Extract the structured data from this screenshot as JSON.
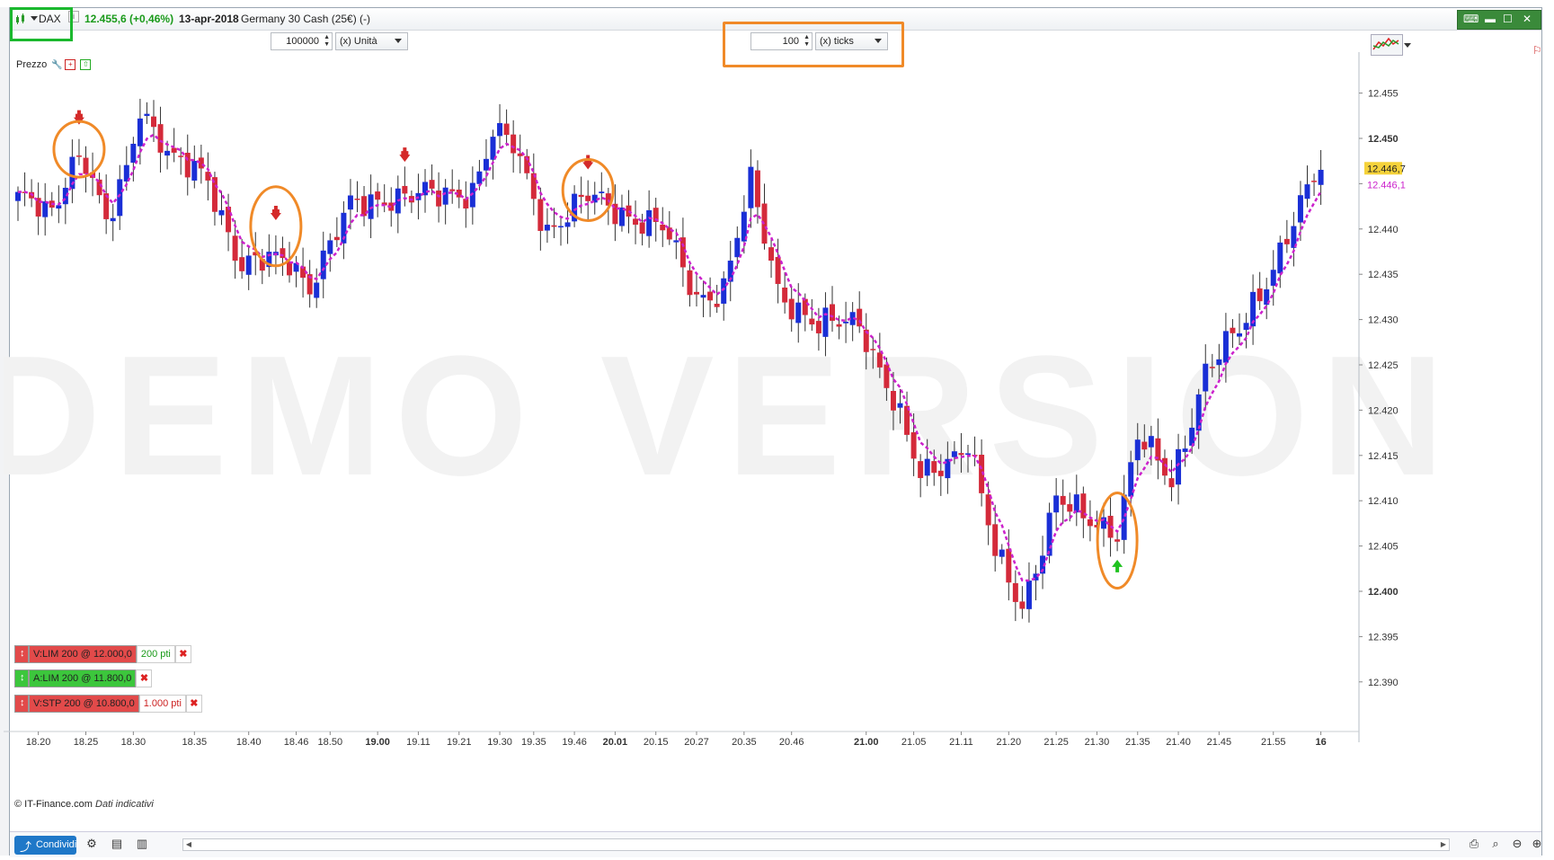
{
  "header": {
    "symbol": "DAX",
    "price_change": "12.455,6 (+0,46%)",
    "date": "13-apr-2018",
    "instrument": "Germany 30 Cash (25€) (-)"
  },
  "toolbar": {
    "units_value": "100000",
    "units_label": "(x) Unità",
    "ticks_value": "100",
    "ticks_label": "(x) ticks"
  },
  "panel": {
    "title": "Prezzo"
  },
  "orders": [
    {
      "label": "V:LIM  200 @ 12.000,0",
      "distance": "200 pti",
      "color": "#e24a4a",
      "distance_color": "#1a9a1a"
    },
    {
      "label": "A:LIM  200 @ 11.800,0",
      "distance": "",
      "color": "#3cc63c",
      "distance_color": "#1a9a1a"
    },
    {
      "label": "V:STP  200 @ 10.800,0",
      "distance": "1.000 pti",
      "color": "#e24a4a",
      "distance_color": "#c22"
    }
  ],
  "footer": {
    "credit": "© IT-Finance.com",
    "note": "Dati indicativi"
  },
  "bottom": {
    "share_label": "Condividi"
  },
  "watermark": "DEMO VERSION",
  "colors": {
    "bull": "#1a2fd6",
    "bear": "#d42a3a",
    "ma": "#cc22cc",
    "highlight": "#f08a28",
    "symbol_frame": "#1bb82e"
  },
  "chart_data": {
    "type": "candlestick",
    "ylim": [
      12.384,
      12.46
    ],
    "y_ticks": [
      {
        "v": 12.455,
        "label": "12.455",
        "bold": false
      },
      {
        "v": 12.45,
        "label": "12.450",
        "bold": true
      },
      {
        "v": 12.445,
        "label": "12.445",
        "bold": false
      },
      {
        "v": 12.44,
        "label": "12.440",
        "bold": false
      },
      {
        "v": 12.435,
        "label": "12.435",
        "bold": false
      },
      {
        "v": 12.43,
        "label": "12.430",
        "bold": false
      },
      {
        "v": 12.425,
        "label": "12.425",
        "bold": false
      },
      {
        "v": 12.42,
        "label": "12.420",
        "bold": false
      },
      {
        "v": 12.415,
        "label": "12.415",
        "bold": false
      },
      {
        "v": 12.41,
        "label": "12.410",
        "bold": false
      },
      {
        "v": 12.405,
        "label": "12.405",
        "bold": false
      },
      {
        "v": 12.4,
        "label": "12.400",
        "bold": true
      },
      {
        "v": 12.395,
        "label": "12.395",
        "bold": false
      },
      {
        "v": 12.39,
        "label": "12.390",
        "bold": false
      }
    ],
    "x_ticks": [
      {
        "i": 3,
        "label": "18.20",
        "bold": false
      },
      {
        "i": 10,
        "label": "18.25",
        "bold": false
      },
      {
        "i": 17,
        "label": "18.30",
        "bold": false
      },
      {
        "i": 26,
        "label": "18.35",
        "bold": false
      },
      {
        "i": 34,
        "label": "18.40",
        "bold": false
      },
      {
        "i": 41,
        "label": "18.46",
        "bold": false
      },
      {
        "i": 46,
        "label": "18.50",
        "bold": false
      },
      {
        "i": 53,
        "label": "19.00",
        "bold": true
      },
      {
        "i": 59,
        "label": "19.11",
        "bold": false
      },
      {
        "i": 65,
        "label": "19.21",
        "bold": false
      },
      {
        "i": 71,
        "label": "19.30",
        "bold": false
      },
      {
        "i": 76,
        "label": "19.35",
        "bold": false
      },
      {
        "i": 82,
        "label": "19.46",
        "bold": false
      },
      {
        "i": 88,
        "label": "20.01",
        "bold": true
      },
      {
        "i": 94,
        "label": "20.15",
        "bold": false
      },
      {
        "i": 100,
        "label": "20.27",
        "bold": false
      },
      {
        "i": 107,
        "label": "20.35",
        "bold": false
      },
      {
        "i": 114,
        "label": "20.46",
        "bold": false
      },
      {
        "i": 125,
        "label": "21.00",
        "bold": true
      },
      {
        "i": 132,
        "label": "21.05",
        "bold": false
      },
      {
        "i": 139,
        "label": "21.11",
        "bold": false
      },
      {
        "i": 146,
        "label": "21.20",
        "bold": false
      },
      {
        "i": 153,
        "label": "21.25",
        "bold": false
      },
      {
        "i": 159,
        "label": "21.30",
        "bold": false
      },
      {
        "i": 165,
        "label": "21.35",
        "bold": false
      },
      {
        "i": 171,
        "label": "21.40",
        "bold": false
      },
      {
        "i": 177,
        "label": "21.45",
        "bold": false
      },
      {
        "i": 185,
        "label": "21.55",
        "bold": false
      },
      {
        "i": 192,
        "label": "16",
        "bold": true
      }
    ],
    "last_price": {
      "value": 12.4467,
      "label": "12.446,7"
    },
    "ma_value": {
      "value": 12.4461,
      "label": "12.446,1"
    },
    "signals": [
      {
        "i": 9,
        "type": "sell"
      },
      {
        "i": 38,
        "type": "sell"
      },
      {
        "i": 57,
        "type": "sell"
      },
      {
        "i": 84,
        "type": "sell"
      },
      {
        "i": 162,
        "type": "buy"
      }
    ],
    "highlights": [
      {
        "i": 9,
        "v": 12.4488
      },
      {
        "i": 38,
        "v": 12.4403
      },
      {
        "i": 84,
        "v": 12.4443
      },
      {
        "i": 162,
        "v": 12.4056
      }
    ]
  }
}
